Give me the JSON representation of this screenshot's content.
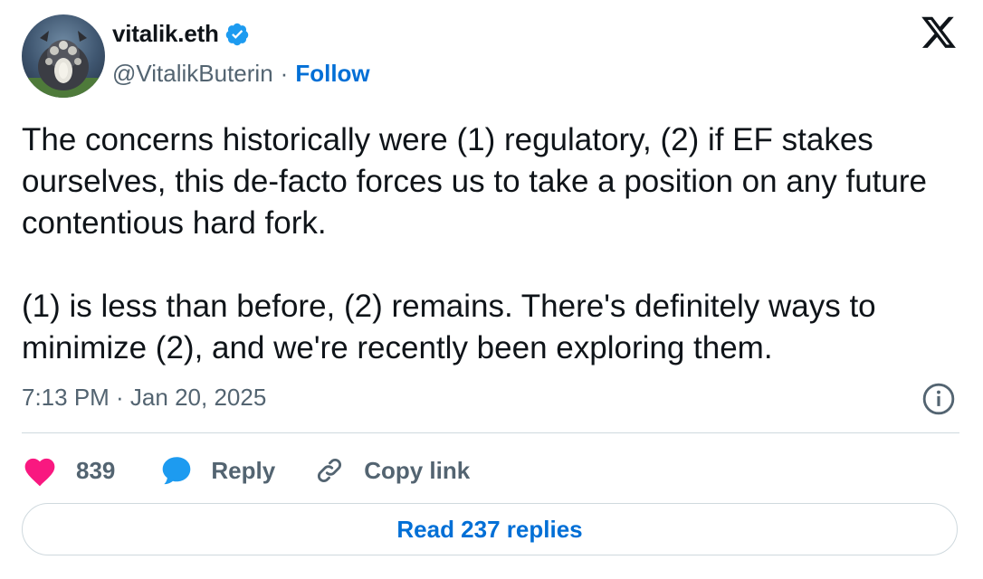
{
  "author": {
    "display_name": "vitalik.eth",
    "handle": "@VitalikButerin",
    "separator": "·",
    "follow_label": "Follow",
    "verified": true
  },
  "tweet": {
    "paragraphs": [
      "The concerns historically were (1) regulatory, (2) if EF stakes ourselves, this de-facto forces us to take a position on any future contentious hard fork.",
      "(1) is less than before, (2) remains. There's definitely ways to minimize (2), and we're recently been exploring them."
    ],
    "timestamp": "7:13 PM · Jan 20, 2025"
  },
  "actions": {
    "like_count": "839",
    "reply_label": "Reply",
    "copy_link_label": "Copy link"
  },
  "read_replies_label": "Read 237 replies",
  "icons": {
    "verified": "verified-badge-icon",
    "brand": "x-logo-icon",
    "info": "info-icon",
    "like": "heart-icon",
    "reply": "speech-bubble-icon",
    "copy": "link-icon"
  },
  "colors": {
    "text": "#0f1419",
    "secondary": "#536471",
    "link": "#006fd6",
    "like": "#f91880",
    "reply": "#1d9bf0",
    "verified": "#1d9bf0",
    "border": "#cfd9de"
  }
}
